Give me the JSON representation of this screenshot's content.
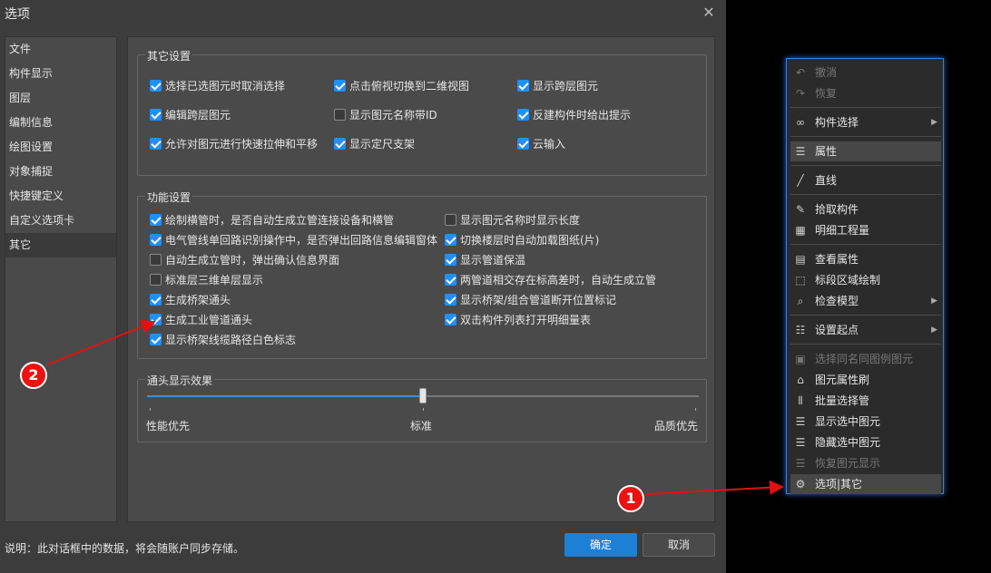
{
  "dialog": {
    "title": "选项",
    "sidebar": [
      "文件",
      "构件显示",
      "图层",
      "编制信息",
      "绘图设置",
      "对象捕捉",
      "快捷键定义",
      "自定义选项卡",
      "其它"
    ],
    "other": {
      "title": "其它设置",
      "items": [
        {
          "label": "选择已选图元时取消选择",
          "checked": true
        },
        {
          "label": "点击俯视切换到二维视图",
          "checked": true
        },
        {
          "label": "显示跨层图元",
          "checked": true
        },
        {
          "label": "编辑跨层图元",
          "checked": true
        },
        {
          "label": "显示图元名称带ID",
          "checked": false
        },
        {
          "label": "反建构件时给出提示",
          "checked": true
        },
        {
          "label": "允许对图元进行快速拉伸和平移",
          "checked": true
        },
        {
          "label": "显示定尺支架",
          "checked": true
        },
        {
          "label": "云输入",
          "checked": true
        }
      ]
    },
    "func": {
      "title": "功能设置",
      "items": [
        {
          "label": "绘制横管时，是否自动生成立管连接设备和横管",
          "checked": true
        },
        {
          "label": "电气管线单回路识别操作中，是否弹出回路信息编辑窗体",
          "checked": true
        },
        {
          "label": "自动生成立管时，弹出确认信息界面",
          "checked": false
        },
        {
          "label": "标准层三维单层显示",
          "checked": false
        },
        {
          "label": "生成桥架通头",
          "checked": true
        },
        {
          "label": "生成工业管道通头",
          "checked": true
        },
        {
          "label": "显示桥架线缆路径白色标志",
          "checked": true
        },
        {
          "label": "显示图元名称时显示长度",
          "checked": false
        },
        {
          "label": "切换楼层时自动加载图纸(片)",
          "checked": true
        },
        {
          "label": "显示管道保温",
          "checked": true
        },
        {
          "label": "两管道相交存在标高差时，自动生成立管",
          "checked": true
        },
        {
          "label": "显示桥架/组合管道断开位置标记",
          "checked": true
        },
        {
          "label": "双击构件列表打开明细量表",
          "checked": true
        }
      ]
    },
    "slider": {
      "title": "通头显示效果",
      "left": "性能优先",
      "mid": "标准",
      "right": "品质优先",
      "value": 0.5
    },
    "note": "说明：此对话框中的数据，将会随账户同步存储。",
    "ok": "确定",
    "cancel": "取消",
    "close": "✕"
  },
  "menu": [
    {
      "label": "撤消",
      "icon": "undo-icon",
      "glyph": "↶",
      "disabled": true
    },
    {
      "label": "恢复",
      "icon": "redo-icon",
      "glyph": "↷",
      "disabled": true
    },
    {
      "label": "构件选择",
      "icon": "link-icon",
      "glyph": "∞",
      "arrow": true
    },
    {
      "label": "属性",
      "icon": "properties-icon",
      "glyph": "☰",
      "selected": true
    },
    {
      "label": "直线",
      "icon": "line-icon",
      "glyph": "╱"
    },
    {
      "label": "拾取构件",
      "icon": "eyedropper-icon",
      "glyph": "✎"
    },
    {
      "label": "明细工程量",
      "icon": "quantity-icon",
      "glyph": "▦"
    },
    {
      "label": "查看属性",
      "icon": "view-properties-icon",
      "glyph": "▤"
    },
    {
      "label": "标段区域绘制",
      "icon": "region-icon",
      "glyph": "⬚"
    },
    {
      "label": "检查模型",
      "icon": "check-model-icon",
      "glyph": "⌕",
      "arrow": true
    },
    {
      "label": "设置起点",
      "icon": "start-point-icon",
      "glyph": "☷",
      "arrow": true
    },
    {
      "label": "选择同名同图例图元",
      "icon": "select-same-icon",
      "glyph": "▣",
      "disabled": true
    },
    {
      "label": "图元属性刷",
      "icon": "brush-icon",
      "glyph": "⌂"
    },
    {
      "label": "批量选择管",
      "icon": "batch-select-icon",
      "glyph": "⫴"
    },
    {
      "label": "显示选中图元",
      "icon": "show-selected-icon",
      "glyph": "☰"
    },
    {
      "label": "隐藏选中图元",
      "icon": "hide-selected-icon",
      "glyph": "☰"
    },
    {
      "label": "恢复图元显示",
      "icon": "restore-display-icon",
      "glyph": "☰",
      "disabled": true
    },
    {
      "label": "选项|其它",
      "icon": "gear-icon",
      "glyph": "⚙",
      "selected": true
    }
  ],
  "badges": {
    "one": "1",
    "two": "2"
  },
  "colors": {
    "accent": "#1e7fd6",
    "annotation": "#e11111",
    "menu_border": "#3e7bd8"
  }
}
